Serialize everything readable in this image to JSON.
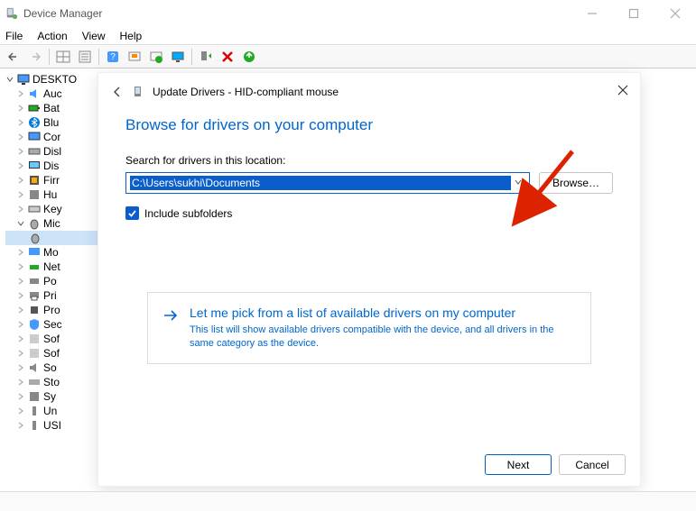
{
  "window": {
    "title": "Device Manager",
    "menus": [
      "File",
      "Action",
      "View",
      "Help"
    ]
  },
  "tree": {
    "root": "DESKTO",
    "items": [
      "Auc",
      "Bat",
      "Blu",
      "Cor",
      "Disl",
      "Dis",
      "Firr",
      "Hu",
      "Key",
      "Mic",
      "",
      "Mo",
      "Net",
      "Po",
      "Pri",
      "Pro",
      "Sec",
      "Sof",
      "Sof",
      "So",
      "Sto",
      "Sy",
      "Un",
      "USI"
    ]
  },
  "dialog": {
    "title": "Update Drivers - HID-compliant mouse",
    "heading": "Browse for drivers on your computer",
    "search_label": "Search for drivers in this location:",
    "path_value": "C:\\Users\\sukhi\\Documents",
    "browse_label": "Browse…",
    "checkbox_label": "Include subfolders",
    "checkbox_checked": true,
    "option_title": "Let me pick from a list of available drivers on my computer",
    "option_desc": "This list will show available drivers compatible with the device, and all drivers in the same category as the device.",
    "next_label": "Next",
    "cancel_label": "Cancel"
  }
}
